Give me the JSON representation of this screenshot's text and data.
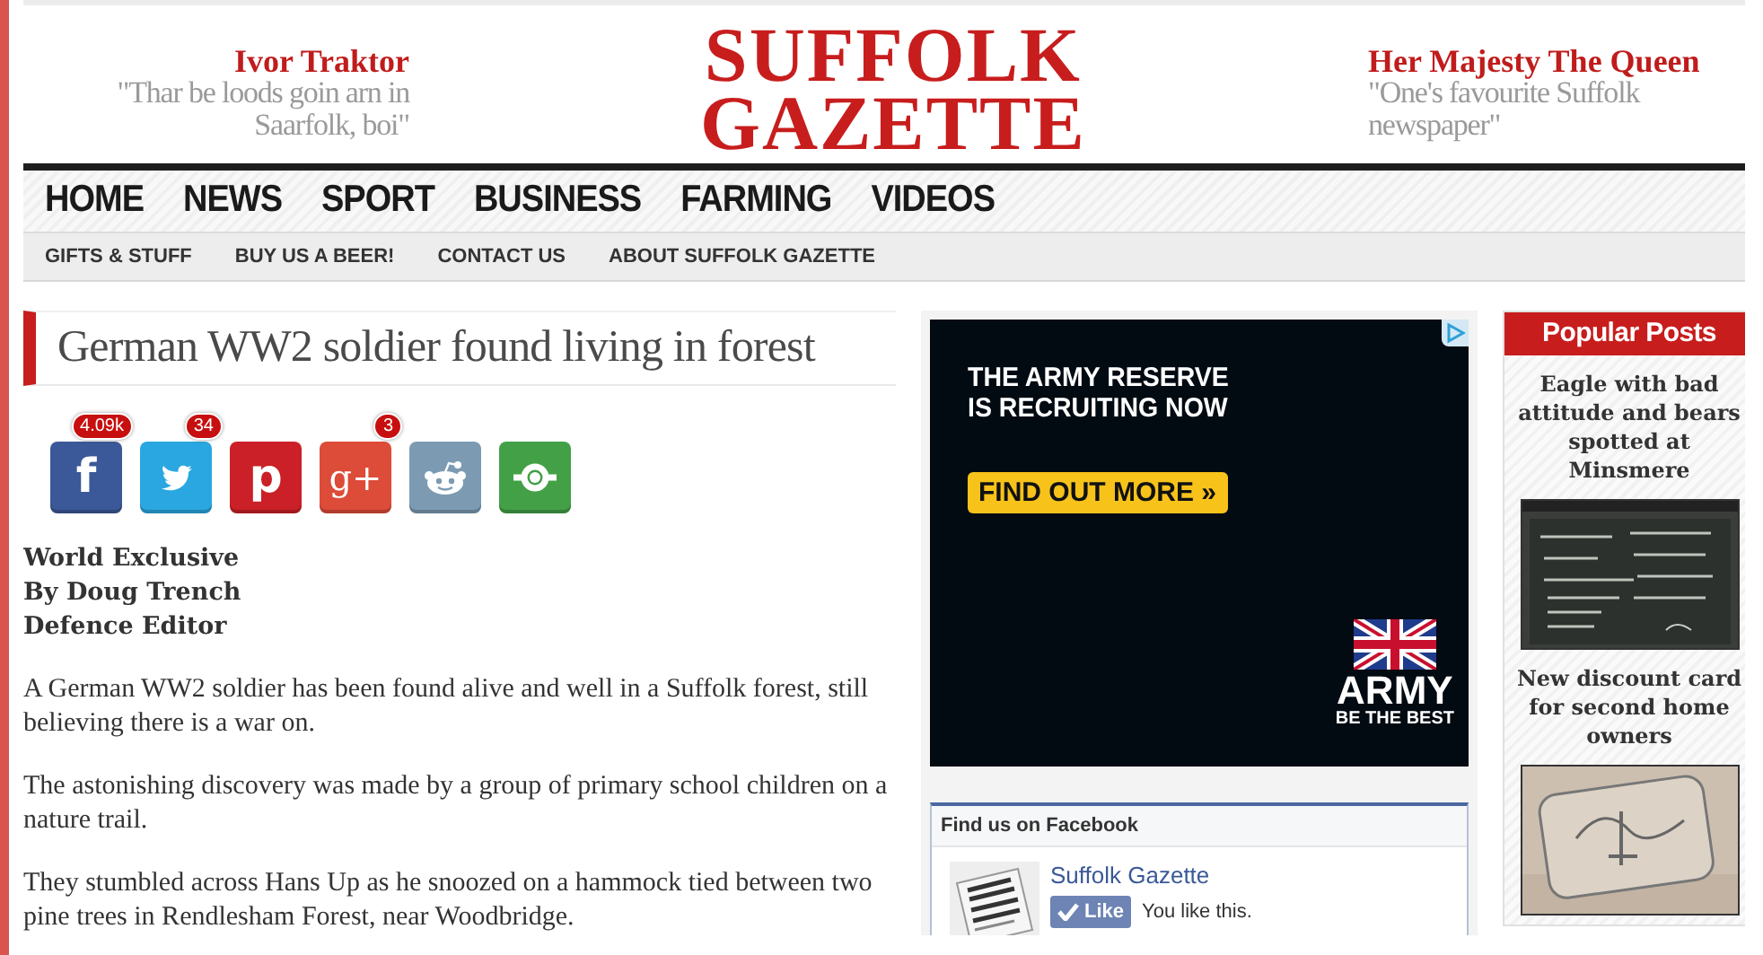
{
  "header": {
    "left_quote": {
      "name": "Ivor Traktor",
      "quote": "\"Thar be loods goin arn in Saarfolk, boi\""
    },
    "logo": [
      "SUFFOLK",
      "GAZETTE"
    ],
    "right_quote": {
      "name": "Her Majesty The Queen",
      "quote": "\"One's favourite Suffolk newspaper\""
    }
  },
  "main_nav": [
    {
      "label": "HOME"
    },
    {
      "label": "NEWS"
    },
    {
      "label": "SPORT"
    },
    {
      "label": "BUSINESS"
    },
    {
      "label": "FARMING"
    },
    {
      "label": "VIDEOS"
    }
  ],
  "sub_nav": [
    {
      "label": "GIFTS & STUFF"
    },
    {
      "label": "BUY US A BEER!"
    },
    {
      "label": "CONTACT US"
    },
    {
      "label": "ABOUT SUFFOLK GAZETTE"
    }
  ],
  "article": {
    "title": "German WW2 soldier found living in forest",
    "share_buttons": [
      {
        "kind": "facebook",
        "glyph": "f",
        "count": "4.09k"
      },
      {
        "kind": "twitter",
        "count": "34"
      },
      {
        "kind": "pinterest",
        "glyph": "p"
      },
      {
        "kind": "googleplus",
        "glyph": "g+",
        "count": "3"
      },
      {
        "kind": "reddit"
      },
      {
        "kind": "sharethis"
      }
    ],
    "byline": [
      "World Exclusive",
      "By Doug Trench",
      "Defence Editor"
    ],
    "paragraphs": [
      "A German WW2 soldier has been found alive and well in a Suffolk forest, still believing there is a war on.",
      "The astonishing discovery was made by a group of primary school children on a nature trail.",
      "They stumbled across Hans Up as he snoozed on a hammock tied between two pine trees in Rendlesham Forest, near Woodbridge."
    ]
  },
  "ad": {
    "headline": [
      "THE ARMY RESERVE",
      "IS RECRUITING NOW"
    ],
    "button": "FIND OUT MORE »",
    "brand": "ARMY",
    "tagline": "BE THE BEST"
  },
  "facebook_box": {
    "title": "Find us on Facebook",
    "page_name": "Suffolk Gazette",
    "like_button": "Like",
    "status": "You like this."
  },
  "popular_posts": {
    "title": "Popular Posts",
    "items": [
      {
        "title": "Eagle with bad attitude and bears spotted at Minsmere"
      },
      {
        "title": "New discount card for second home owners"
      }
    ]
  }
}
